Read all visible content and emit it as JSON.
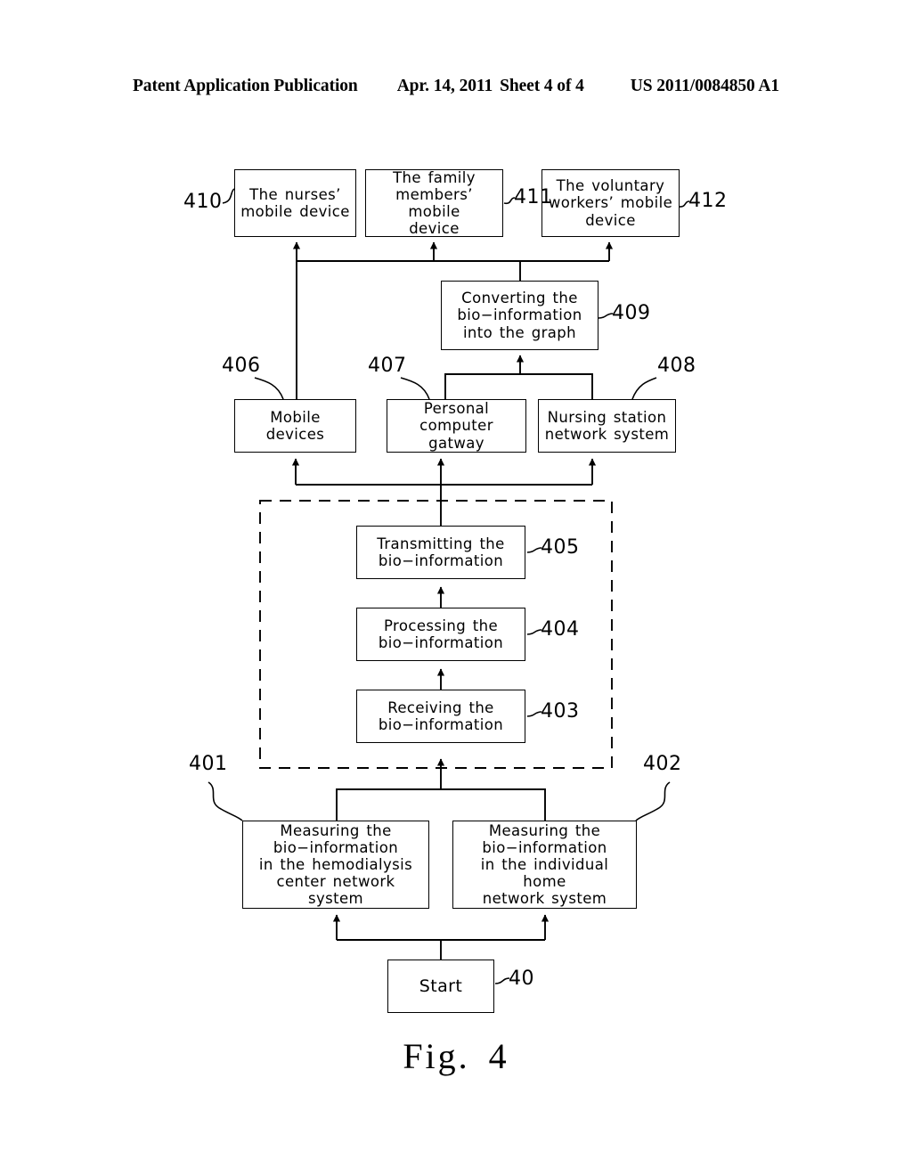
{
  "header": {
    "publication": "Patent Application Publication",
    "date": "Apr. 14, 2011",
    "sheet": "Sheet 4 of 4",
    "patent_number": "US 2011/0084850 A1"
  },
  "figure": {
    "caption": "Fig.  4"
  },
  "nodes": {
    "n410": {
      "label": "The nurses’\nmobile  device"
    },
    "n411": {
      "label": "The family\nmembers’  mobile\ndevice"
    },
    "n412": {
      "label": "The voluntary\nworkers’  mobile\ndevice"
    },
    "n409": {
      "label": "Converting  the\nbio−information\ninto  the  graph"
    },
    "n406": {
      "label": "Mobile  devices"
    },
    "n407": {
      "label": "Personal\ncomputer  gatway"
    },
    "n408": {
      "label": "Nursing  station\nnetwork  system"
    },
    "n405": {
      "label": "Transmitting  the\nbio−information"
    },
    "n404": {
      "label": "Processing  the\nbio−information"
    },
    "n403": {
      "label": "Receiving  the\nbio−information"
    },
    "n401": {
      "label": "Measuring  the\nbio−information\nin  the  hemodialysis\ncenter  network  system"
    },
    "n402": {
      "label": "Measuring  the\nbio−information\nin  the  individual  home\nnetwork  system"
    },
    "n40": {
      "label": "Start"
    }
  },
  "refs": {
    "r410": "410",
    "r411": "411",
    "r412": "412",
    "r409": "409",
    "r406": "406",
    "r407": "407",
    "r408": "408",
    "r405": "405",
    "r404": "404",
    "r403": "403",
    "r401": "401",
    "r402": "402",
    "r40": "40"
  },
  "style": {
    "line_color": "#000000",
    "box_fill": "#ffffff"
  }
}
